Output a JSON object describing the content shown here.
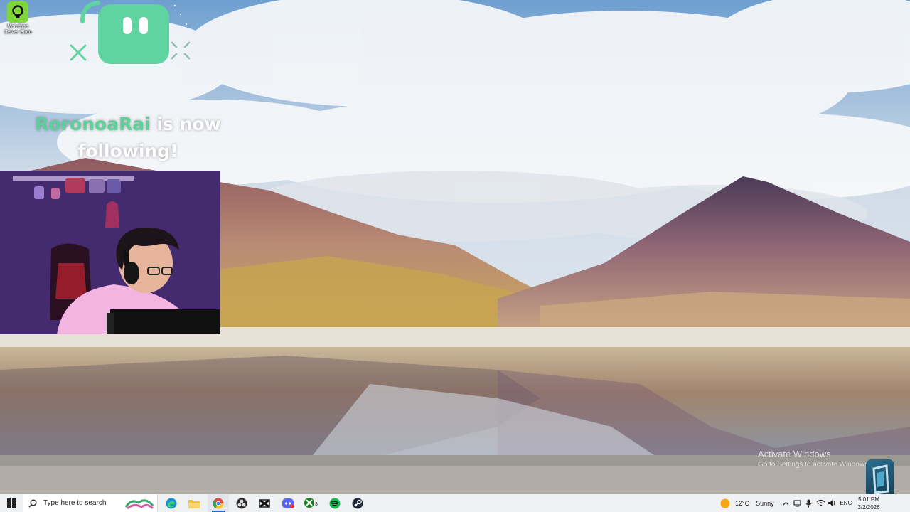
{
  "desktop": {
    "icon": {
      "label": "Marathon Server Slam",
      "icon": "marathon-app-icon"
    }
  },
  "alert": {
    "username": "RoronoaRai",
    "message_line1": " is now",
    "message_line2": "following!",
    "logo_icon": "streamlabs-bot-logo",
    "accent_color": "#5fcf9a"
  },
  "webcam": {
    "icon": "webcam-feed"
  },
  "watermark": {
    "title": "Activate Windows",
    "subtitle": "Go to Settings to activate Windows."
  },
  "taskbar": {
    "start_icon": "windows-start-icon",
    "search_placeholder": "Type here to search",
    "apps": [
      {
        "name": "edge",
        "icon": "edge-icon"
      },
      {
        "name": "file-explorer",
        "icon": "folder-icon"
      },
      {
        "name": "chrome",
        "icon": "chrome-icon",
        "active": true
      },
      {
        "name": "obs",
        "icon": "obs-icon"
      },
      {
        "name": "capcut",
        "icon": "capcut-icon"
      },
      {
        "name": "discord",
        "icon": "discord-icon"
      },
      {
        "name": "xbox",
        "icon": "xbox-icon",
        "badge": "3"
      },
      {
        "name": "spotify",
        "icon": "spotify-icon"
      },
      {
        "name": "steam",
        "icon": "steam-icon"
      }
    ],
    "weather": {
      "temp": "12°C",
      "condition": "Sunny",
      "icon": "sun-icon"
    },
    "tray": {
      "language": "ENG"
    },
    "clock": {
      "time": "5:01 PM",
      "date": "3/2/2026"
    }
  },
  "colors": {
    "taskbar_bg": "#f0f1f3",
    "accent": "#1f6fd1"
  }
}
